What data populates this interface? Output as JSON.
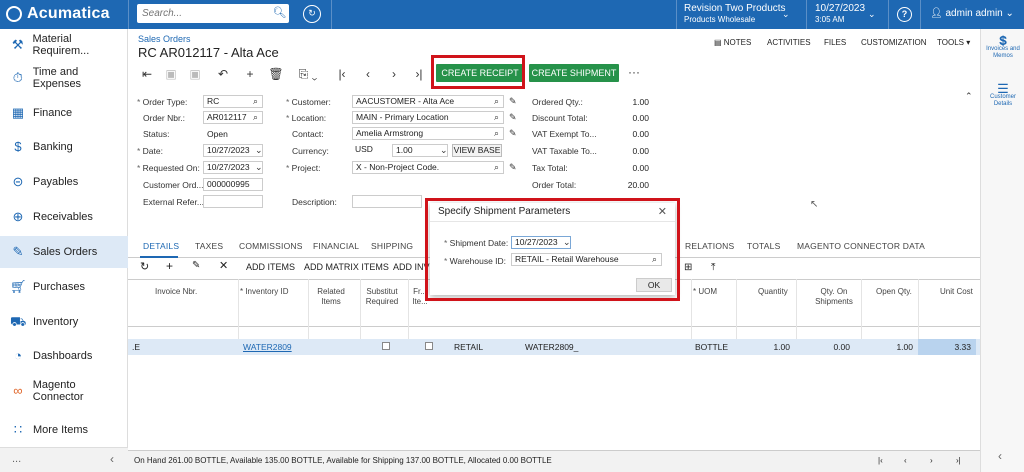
{
  "topbar": {
    "logo": "Acumatica",
    "search_placeholder": "Search...",
    "company_name": "Revision Two Products",
    "company_sub": "Products Wholesale",
    "date": "10/27/2023",
    "time": "3:05 AM",
    "user": "admin admin"
  },
  "sidebar": {
    "items": [
      {
        "label": "Material Requirem...",
        "icon": "tools-icon"
      },
      {
        "label": "Time and Expenses",
        "icon": "stopwatch-icon"
      },
      {
        "label": "Finance",
        "icon": "calculator-icon"
      },
      {
        "label": "Banking",
        "icon": "dollar-icon"
      },
      {
        "label": "Payables",
        "icon": "minus-circle-icon"
      },
      {
        "label": "Receivables",
        "icon": "plus-circle-icon"
      },
      {
        "label": "Sales Orders",
        "icon": "edit-icon"
      },
      {
        "label": "Purchases",
        "icon": "cart-icon"
      },
      {
        "label": "Inventory",
        "icon": "truck-icon"
      },
      {
        "label": "Dashboards",
        "icon": "gauge-icon"
      },
      {
        "label": "Magento Connector",
        "icon": "connector-icon"
      },
      {
        "label": "More Items",
        "icon": "grid-icon"
      }
    ],
    "bottom_more": "...",
    "bottom_collapse": "‹"
  },
  "header": {
    "breadcrumb": "Sales Orders",
    "title": "RC AR012117 - Alta Ace",
    "links": [
      "NOTES",
      "ACTIVITIES",
      "FILES",
      "CUSTOMIZATION",
      "TOOLS"
    ]
  },
  "toolbar": {
    "create_receipt": "CREATE RECEIPT",
    "create_shipment": "CREATE SHIPMENT",
    "more": "···"
  },
  "form": {
    "order_type_label": "Order Type:",
    "order_type": "RC",
    "order_nbr_label": "Order Nbr.:",
    "order_nbr": "AR012117",
    "status_label": "Status:",
    "status": "Open",
    "date_label": "Date:",
    "date": "10/27/2023",
    "requested_on_label": "Requested On:",
    "requested_on": "10/27/2023",
    "customer_ord_label": "Customer Ord...",
    "customer_ord": "000000995",
    "external_ref_label": "External Refer...",
    "customer_label": "Customer:",
    "customer": "AACUSTOMER - Alta Ace",
    "location_label": "Location:",
    "location": "MAIN - Primary Location",
    "contact_label": "Contact:",
    "contact": "Amelia Armstrong",
    "currency_label": "Currency:",
    "currency": "USD",
    "rate": "1.00",
    "view_base": "VIEW BASE",
    "project_label": "Project:",
    "project": "X - Non-Project Code.",
    "description_label": "Description:",
    "ordered_qty_label": "Ordered Qty.:",
    "ordered_qty": "1.00",
    "discount_total_label": "Discount Total:",
    "discount_total": "0.00",
    "vat_exempt_label": "VAT Exempt To...",
    "vat_exempt": "0.00",
    "vat_taxable_label": "VAT Taxable To...",
    "vat_taxable": "0.00",
    "tax_total_label": "Tax Total:",
    "tax_total": "0.00",
    "order_total_label": "Order Total:",
    "order_total": "20.00"
  },
  "tabs": [
    "DETAILS",
    "TAXES",
    "COMMISSIONS",
    "FINANCIAL",
    "SHIPPING",
    "RELATIONS",
    "TOTALS",
    "MAGENTO CONNECTOR DATA"
  ],
  "grid_toolbar": [
    "ADD ITEMS",
    "ADD MATRIX ITEMS",
    "ADD INV"
  ],
  "grid": {
    "headers": [
      "Invoice Nbr.",
      "* Inventory ID",
      "Related Items",
      "Substitut Required",
      "Fr... Ite...",
      "* UOM",
      "Quantity",
      "Qty. On Shipments",
      "Open Qty.",
      "Unit Cost"
    ],
    "row": {
      "lead": ".E",
      "inventory_id": "WATER2809",
      "warehouse": "RETAIL",
      "description": "WATER2809_",
      "uom": "BOTTLE",
      "quantity": "1.00",
      "qty_on_shipments": "0.00",
      "open_qty": "1.00",
      "unit_cost": "3.33"
    }
  },
  "status_bar": "On Hand 261.00 BOTTLE, Available 135.00 BOTTLE, Available for Shipping 137.00 BOTTLE, Allocated 0.00 BOTTLE",
  "dialog": {
    "title": "Specify Shipment Parameters",
    "shipment_date_label": "Shipment Date:",
    "shipment_date": "10/27/2023",
    "warehouse_label": "Warehouse ID:",
    "warehouse": "RETAIL - Retail Warehouse",
    "ok": "OK"
  },
  "right_panel": [
    {
      "label": "Invoices and Memos",
      "icon": "invoice-icon"
    },
    {
      "label": "Customer Details",
      "icon": "details-icon"
    }
  ],
  "colors": {
    "brand": "#1e68b3",
    "action_green": "#26924a",
    "highlight_red": "#d0131a"
  }
}
